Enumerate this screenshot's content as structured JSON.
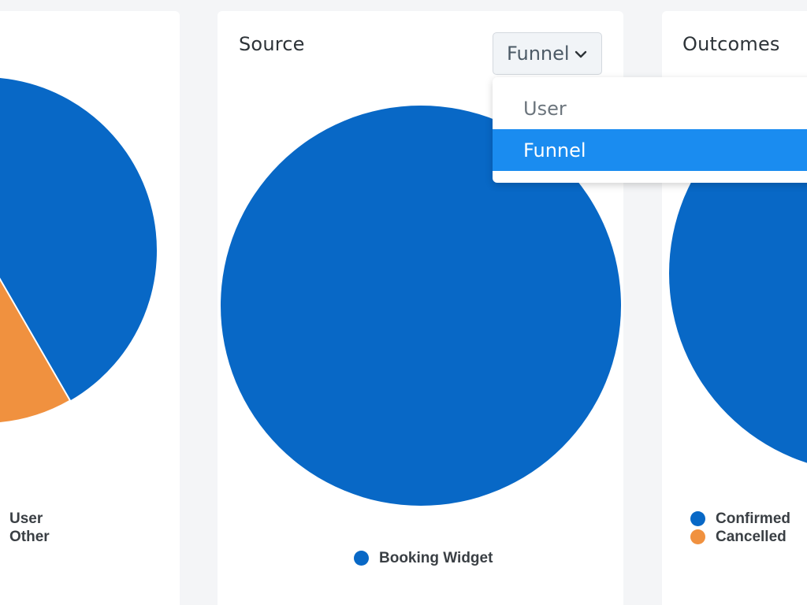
{
  "cards": {
    "left": {
      "legend": [
        {
          "label": "User",
          "color": "#f47f6b"
        },
        {
          "label": "Other",
          "color": "#f0913f"
        }
      ]
    },
    "source": {
      "title": "Source",
      "select": {
        "value": "Funnel",
        "options": [
          "User",
          "Funnel"
        ]
      },
      "legend": [
        {
          "label": "Booking Widget",
          "color": "#0868c6"
        }
      ]
    },
    "outcomes": {
      "title": "Outcomes",
      "legend": [
        {
          "label": "Confirmed",
          "color": "#0868c6"
        },
        {
          "label": "Cancelled",
          "color": "#f0913f"
        }
      ]
    }
  },
  "colors": {
    "blue": "#0868c6",
    "orange": "#f0913f",
    "selected": "#1a8cf0"
  },
  "chart_data": [
    {
      "type": "pie",
      "title": "",
      "labels": [
        "User",
        "Other",
        "unlabeled (blue)"
      ],
      "values": [
        0,
        58,
        42
      ]
    },
    {
      "type": "pie",
      "title": "Source",
      "labels": [
        "Booking Widget"
      ],
      "values": [
        100
      ]
    },
    {
      "type": "pie",
      "title": "Outcomes",
      "labels": [
        "Confirmed",
        "Cancelled"
      ],
      "values": [
        100,
        0
      ]
    }
  ]
}
